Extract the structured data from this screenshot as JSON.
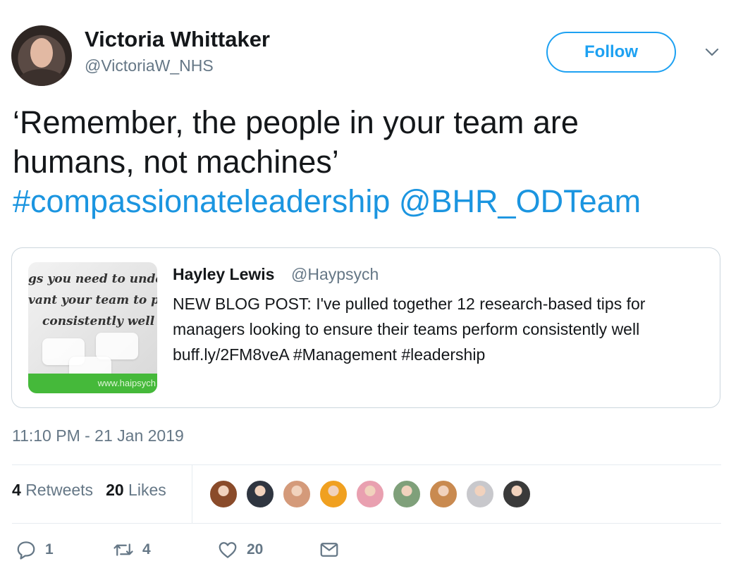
{
  "author": {
    "name": "Victoria Whittaker",
    "handle": "@VictoriaW_NHS"
  },
  "follow_label": "Follow",
  "tweet": {
    "line1": "‘Remember, the people in your team are",
    "line2": "humans, not machines’",
    "hashtag": "#compassionateleadership",
    "mention": "@BHR_ODTeam"
  },
  "quote": {
    "name": "Hayley Lewis",
    "handle": "@Haypsych",
    "text": "NEW BLOG POST: I've pulled together 12 research-based tips for managers looking to ensure their teams perform consistently well buff.ly/2FM8veA #Management #leadership",
    "thumbnail": {
      "line1": "gs you need to unders",
      "line2": "vant your team to per",
      "line3": "consistently well",
      "site": "www.haipsych"
    }
  },
  "timestamp": "11:10 PM - 21 Jan 2019",
  "stats": {
    "retweets_count": "4",
    "retweets_label": "Retweets",
    "likes_count": "20",
    "likes_label": "Likes"
  },
  "liker_colors": [
    "#8a4b2a",
    "#2f3540",
    "#d49a7a",
    "#f0a020",
    "#e9a0b0",
    "#7fa07a",
    "#c98a50",
    "#c8c8cc",
    "#3a3a3a"
  ],
  "actions": {
    "reply_count": "1",
    "retweet_count": "4",
    "like_count": "20"
  },
  "colors": {
    "accent": "#1da1f2",
    "link": "#1b95e0",
    "muted": "#657786"
  }
}
